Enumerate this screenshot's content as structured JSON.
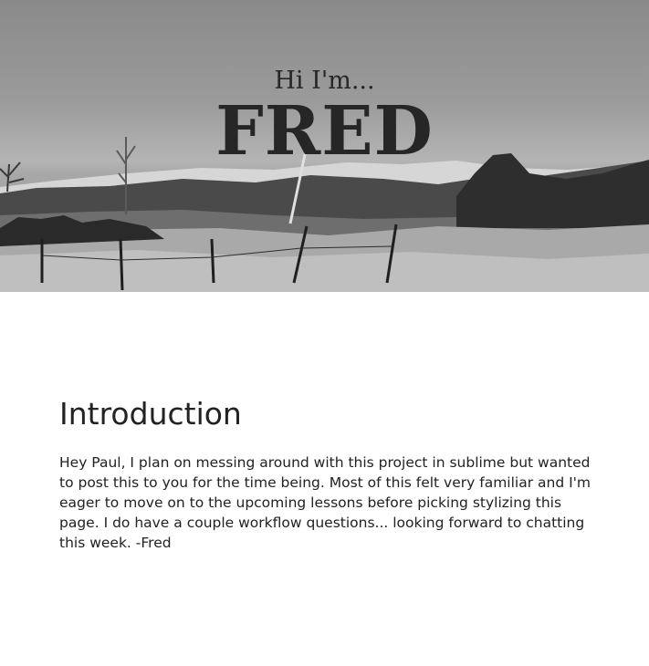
{
  "hero": {
    "greeting": "Hi I'm...",
    "name": "FRED"
  },
  "intro": {
    "title": "Introduction",
    "body": "Hey Paul, I plan on messing around with this project in sublime but wanted to post this to you for the time being. Most of this felt very familiar and I'm eager to move on to the upcoming lessons before picking stylizing this page. I do have a couple workflow questions... looking forward to chatting this week. -Fred"
  },
  "colors": {
    "text": "#222222",
    "page_background": "#ffffff"
  }
}
